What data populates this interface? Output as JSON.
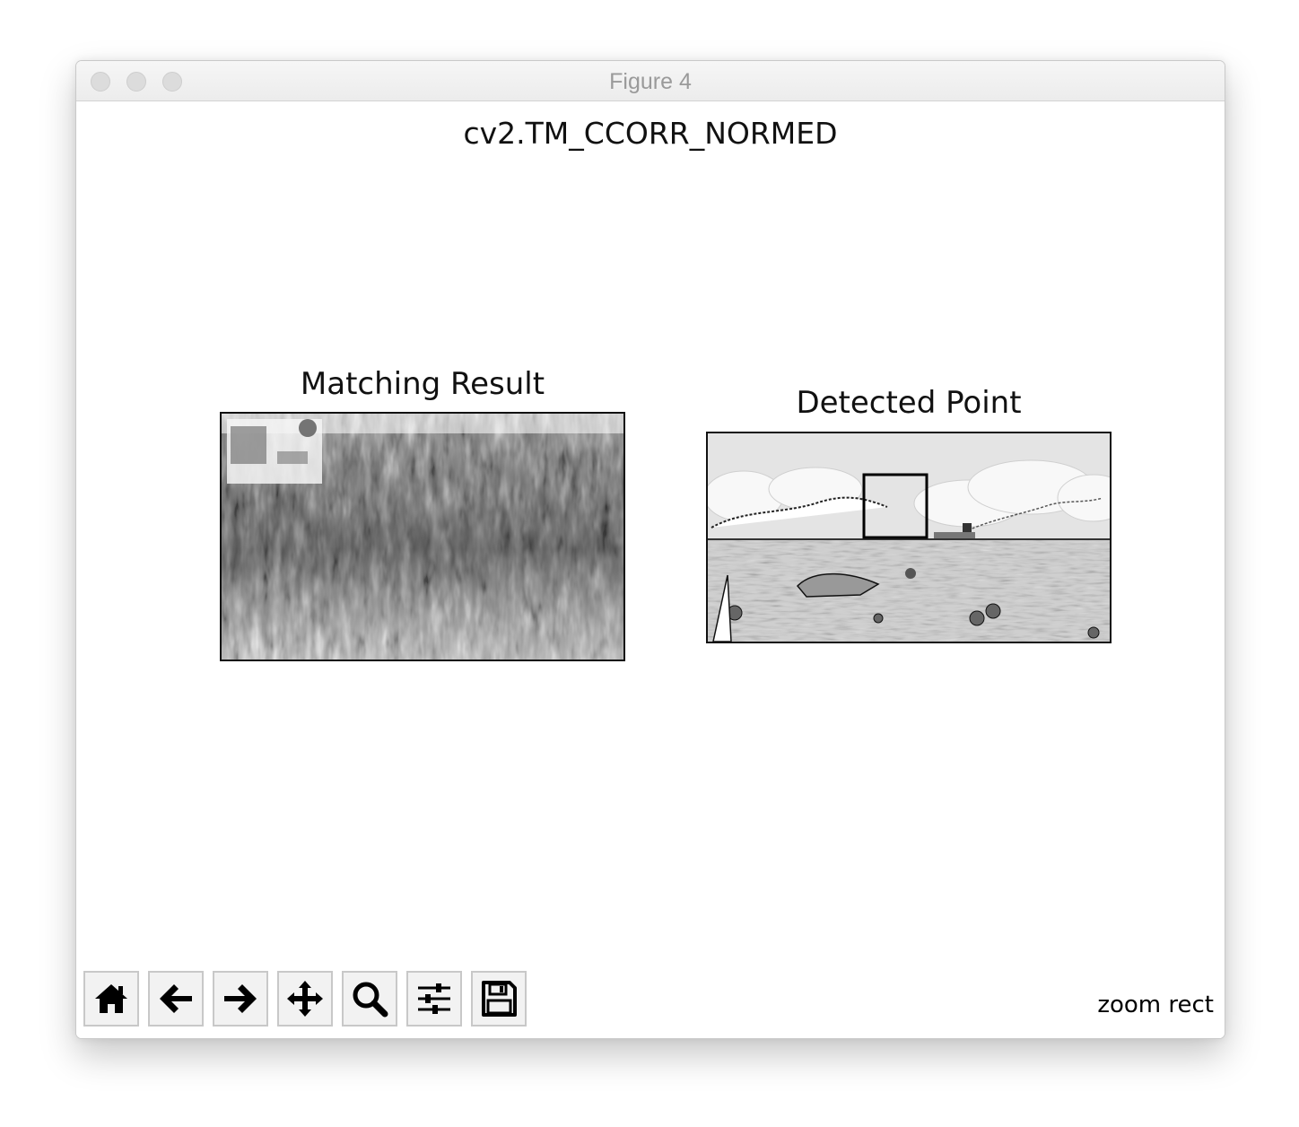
{
  "window": {
    "title": "Figure 4"
  },
  "figure": {
    "suptitle": "cv2.TM_CCORR_NORMED",
    "left_axes": {
      "title": "Matching Result",
      "image": "grayscale-matching-result-map"
    },
    "right_axes": {
      "title": "Detected Point",
      "image": "beach-sea-cartoon-scene"
    }
  },
  "toolbar": {
    "buttons": [
      {
        "name": "home",
        "icon": "home-icon"
      },
      {
        "name": "back",
        "icon": "arrow-left-icon"
      },
      {
        "name": "forward",
        "icon": "arrow-right-icon"
      },
      {
        "name": "pan",
        "icon": "move-icon"
      },
      {
        "name": "zoom",
        "icon": "magnifier-icon"
      },
      {
        "name": "configure-subplots",
        "icon": "sliders-icon"
      },
      {
        "name": "save",
        "icon": "floppy-disk-icon"
      }
    ],
    "status": "zoom rect"
  },
  "colors": {
    "window_bg": "#ffffff",
    "titlebar": "#ececec",
    "frame": "#111111"
  }
}
